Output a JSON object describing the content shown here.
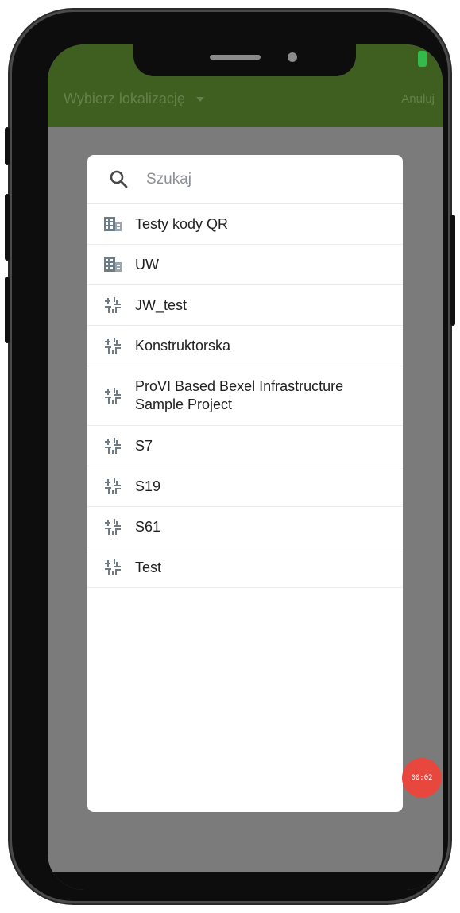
{
  "status_bar": {
    "battery_color": "#35b94a"
  },
  "app_bar": {
    "title": "Wybierz lokalizację",
    "title_dropdown_icon": "caret-down-icon",
    "cancel_label": "Anuluj",
    "background_color": "#3e5f1f"
  },
  "dialog": {
    "search": {
      "placeholder": "Szukaj",
      "value": "",
      "icon": "search-icon"
    },
    "items": [
      {
        "label": "Testy kody QR",
        "icon": "building-icon"
      },
      {
        "label": "UW",
        "icon": "building-icon"
      },
      {
        "label": "JW_test",
        "icon": "grid-project-icon"
      },
      {
        "label": "Konstruktorska",
        "icon": "grid-project-icon"
      },
      {
        "label": "ProVI Based Bexel Infrastructure Sample Project",
        "icon": "grid-project-icon"
      },
      {
        "label": "S7",
        "icon": "grid-project-icon"
      },
      {
        "label": "S19",
        "icon": "grid-project-icon"
      },
      {
        "label": "S61",
        "icon": "grid-project-icon"
      },
      {
        "label": "Test",
        "icon": "grid-project-icon"
      }
    ]
  },
  "recording_badge": {
    "time": "00:02",
    "color": "#e8473e"
  }
}
